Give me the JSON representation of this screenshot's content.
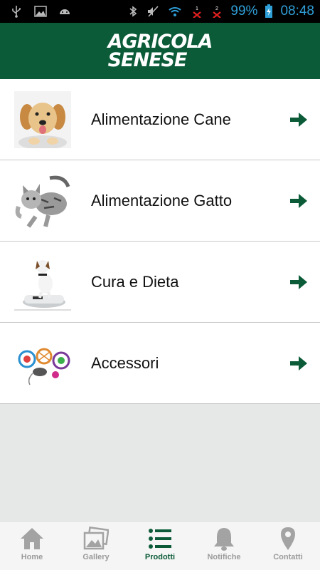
{
  "status_bar": {
    "battery_percent": "99%",
    "time": "08:48",
    "icons": [
      "usb-icon",
      "image-icon",
      "android-icon",
      "bluetooth-icon",
      "mute-icon",
      "wifi-icon",
      "sim1-no-signal-icon",
      "sim2-no-signal-icon",
      "battery-charging-icon"
    ]
  },
  "header": {
    "logo_line1": "AGRICOLA",
    "logo_line2": "SENESE"
  },
  "categories": [
    {
      "label": "Alimentazione Cane",
      "image": "puppy-photo"
    },
    {
      "label": "Alimentazione Gatto",
      "image": "kitten-photo"
    },
    {
      "label": "Cura e Dieta",
      "image": "dog-on-scale-photo"
    },
    {
      "label": "Accessori",
      "image": "cat-toys-photo"
    }
  ],
  "tabbar": {
    "tabs": [
      {
        "label": "Home",
        "icon": "home-icon",
        "active": false
      },
      {
        "label": "Gallery",
        "icon": "gallery-icon",
        "active": false
      },
      {
        "label": "Prodotti",
        "icon": "list-icon",
        "active": true
      },
      {
        "label": "Notifiche",
        "icon": "bell-icon",
        "active": false
      },
      {
        "label": "Contatti",
        "icon": "location-pin-icon",
        "active": false
      }
    ]
  },
  "colors": {
    "brand_green": "#0b5b38",
    "status_blue": "#2f9fd8",
    "inactive_tab": "#9b9b9b"
  }
}
